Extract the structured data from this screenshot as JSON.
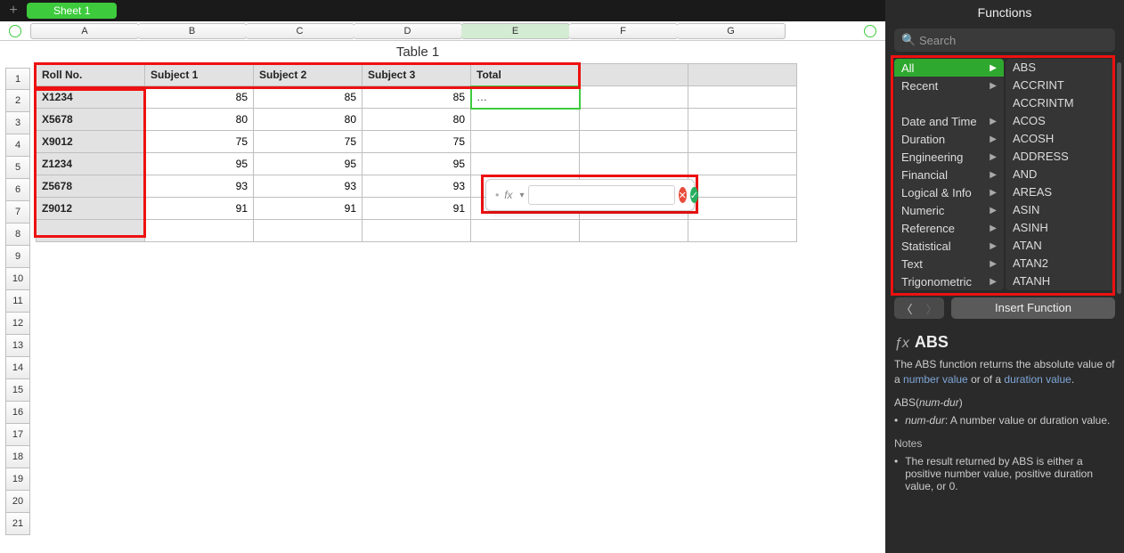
{
  "tabbar": {
    "sheet_label": "Sheet 1"
  },
  "columns": [
    "A",
    "B",
    "C",
    "D",
    "E",
    "F",
    "G"
  ],
  "table": {
    "title": "Table 1",
    "headers": [
      "Roll No.",
      "Subject 1",
      "Subject 2",
      "Subject 3",
      "Total"
    ],
    "rows": [
      {
        "roll": "X1234",
        "s1": "85",
        "s2": "85",
        "s3": "85",
        "total": "…"
      },
      {
        "roll": "X5678",
        "s1": "80",
        "s2": "80",
        "s3": "80",
        "total": ""
      },
      {
        "roll": "X9012",
        "s1": "75",
        "s2": "75",
        "s3": "75",
        "total": ""
      },
      {
        "roll": "Z1234",
        "s1": "95",
        "s2": "95",
        "s3": "95",
        "total": ""
      },
      {
        "roll": "Z5678",
        "s1": "93",
        "s2": "93",
        "s3": "93",
        "total": ""
      },
      {
        "roll": "Z9012",
        "s1": "91",
        "s2": "91",
        "s3": "91",
        "total": ""
      }
    ],
    "empty_rows_shown": 21
  },
  "formula_editor": {
    "fx_label": "fx",
    "value": ""
  },
  "functions_panel": {
    "title": "Functions",
    "search_placeholder": "Search",
    "categories": [
      "All",
      "Recent",
      "",
      "Date and Time",
      "Duration",
      "Engineering",
      "Financial",
      "Logical & Info",
      "Numeric",
      "Reference",
      "Statistical",
      "Text",
      "Trigonometric"
    ],
    "selected_category": "All",
    "function_names": [
      "ABS",
      "ACCRINT",
      "ACCRINTM",
      "ACOS",
      "ACOSH",
      "ADDRESS",
      "AND",
      "AREAS",
      "ASIN",
      "ASINH",
      "ATAN",
      "ATAN2",
      "ATANH"
    ],
    "insert_label": "Insert Function",
    "detail": {
      "name": "ABS",
      "desc_pre": "The ABS function returns the absolute value of a ",
      "kw1": "number value",
      "desc_mid": " or of a ",
      "kw2": "duration value",
      "desc_post": ".",
      "signature_pre": "ABS(",
      "signature_param": "num-dur",
      "signature_post": ")",
      "param_name": "num-dur",
      "param_desc": ": A number value or duration value.",
      "notes_heading": "Notes",
      "note1": "The result returned by ABS is either a positive number value, positive duration value, or 0."
    }
  }
}
